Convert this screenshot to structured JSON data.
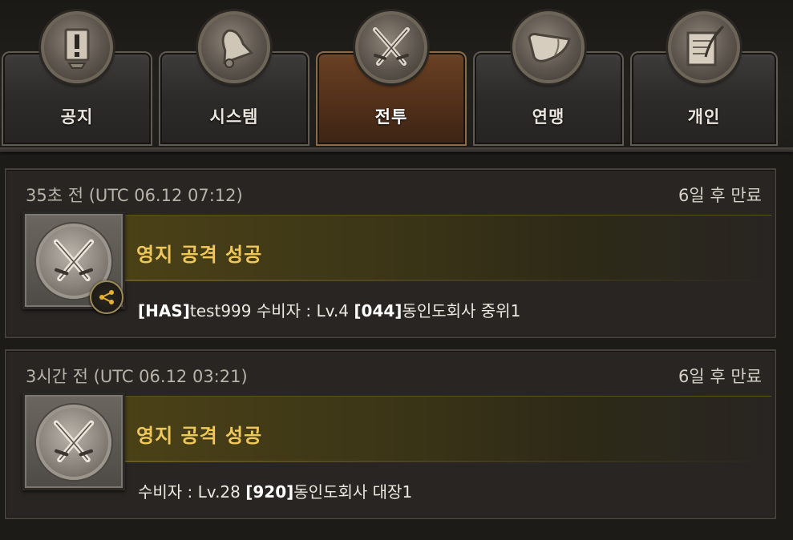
{
  "tabs": [
    {
      "label": "공지",
      "icon": "notice-board-icon",
      "active": false
    },
    {
      "label": "시스템",
      "icon": "bell-icon",
      "active": false
    },
    {
      "label": "전투",
      "icon": "crossed-swords-icon",
      "active": true
    },
    {
      "label": "연맹",
      "icon": "horn-icon",
      "active": false
    },
    {
      "label": "개인",
      "icon": "scroll-quill-icon",
      "active": false
    }
  ],
  "messages": [
    {
      "time": "35초 전 (UTC 06.12 07:12)",
      "expire": "6일 후 만료",
      "title": "영지 공격 성공",
      "icon": "crossed-swords-icon",
      "has_share": true,
      "body": {
        "attacker_tag": "[HAS]",
        "attacker_name": "test999",
        "defender_label": " 수비자 : Lv.4 ",
        "defender_tag": "[044]",
        "defender_name": "동인도회사 중위1"
      }
    },
    {
      "time": "3시간 전 (UTC 06.12 03:21)",
      "expire": "6일 후 만료",
      "title": "영지 공격 성공",
      "icon": "crossed-swords-icon",
      "has_share": false,
      "body": {
        "defender_label": "수비자 : Lv.28 ",
        "defender_tag": "[920]",
        "defender_name": "동인도회사 대장1"
      }
    }
  ],
  "colors": {
    "title": "#f0c85a",
    "active_tab": "#5a341c",
    "share_accent": "#e8b030"
  }
}
